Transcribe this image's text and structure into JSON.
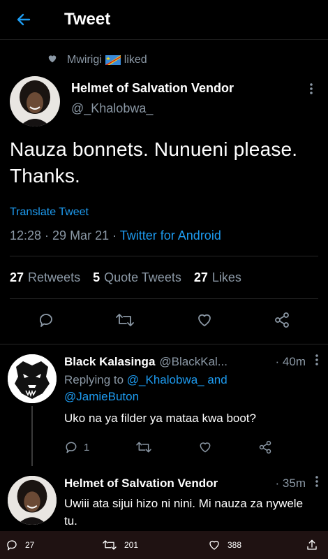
{
  "header": {
    "title": "Tweet"
  },
  "social_context": {
    "user": "Mwirigi",
    "action": "liked"
  },
  "tweet": {
    "author_name": "Helmet of Salvation Vendor",
    "author_handle": "@_Khalobwa_",
    "text_line1": "Nauza bonnets. Nunueni please.",
    "text_line2": "Thanks.",
    "translate": "Translate Tweet",
    "time": "12:28 · 29 Mar 21 · ",
    "app": "Twitter for Android",
    "retweets_count": "27",
    "retweets_label": "Retweets",
    "quotes_count": "5",
    "quotes_label": "Quote Tweets",
    "likes_count": "27",
    "likes_label": "Likes"
  },
  "replies": [
    {
      "name": "Black Kalasinga",
      "handle": "@BlackKal...",
      "time": "· 40m",
      "replying_prefix": "Replying to ",
      "replying_to1": "@_Khalobwa_ and",
      "replying_to2": "@JamieButon",
      "text": "Uko na ya filder ya mataa kwa boot?",
      "reply_count": "1"
    },
    {
      "name": "Helmet of Salvation Vendor",
      "handle": "",
      "time": "· 35m",
      "text": "Uwiii ata sijui hizo ni nini. Mi nauza za nywele tu."
    }
  ],
  "bottom_bar": {
    "replies": "27",
    "retweets": "201",
    "likes": "388"
  },
  "colors": {
    "accent": "#1d9bf0",
    "muted": "#8b98a5",
    "background": "#000000"
  }
}
